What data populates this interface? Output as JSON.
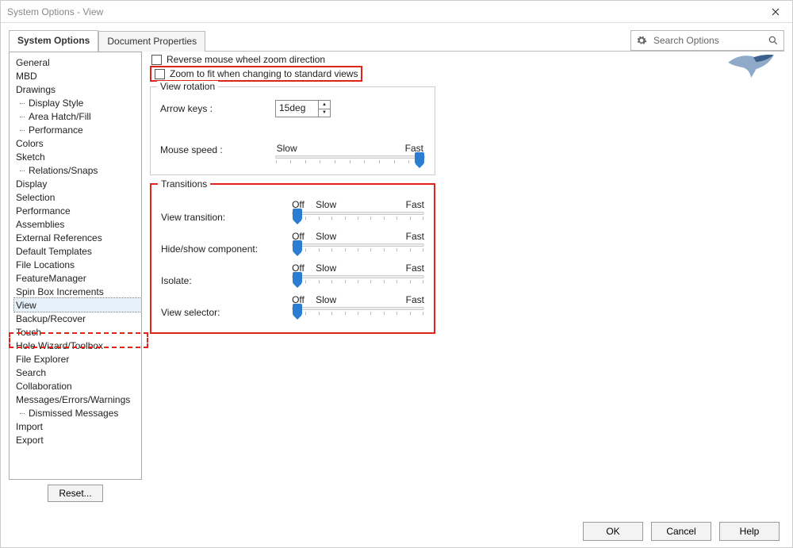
{
  "window": {
    "title": "System Options - View"
  },
  "tabs": {
    "system_options": "System Options",
    "document_properties": "Document Properties"
  },
  "search": {
    "placeholder": "Search Options"
  },
  "sidebar": {
    "items": [
      {
        "label": "General"
      },
      {
        "label": "MBD"
      },
      {
        "label": "Drawings"
      },
      {
        "label": "Display Style",
        "child": true
      },
      {
        "label": "Area Hatch/Fill",
        "child": true
      },
      {
        "label": "Performance",
        "child": true
      },
      {
        "label": "Colors"
      },
      {
        "label": "Sketch"
      },
      {
        "label": "Relations/Snaps",
        "child": true
      },
      {
        "label": "Display"
      },
      {
        "label": "Selection"
      },
      {
        "label": "Performance"
      },
      {
        "label": "Assemblies"
      },
      {
        "label": "External References"
      },
      {
        "label": "Default Templates"
      },
      {
        "label": "File Locations"
      },
      {
        "label": "FeatureManager"
      },
      {
        "label": "Spin Box Increments"
      },
      {
        "label": "View",
        "active": true
      },
      {
        "label": "Backup/Recover"
      },
      {
        "label": "Touch"
      },
      {
        "label": "Hole Wizard/Toolbox"
      },
      {
        "label": "File Explorer"
      },
      {
        "label": "Search"
      },
      {
        "label": "Collaboration"
      },
      {
        "label": "Messages/Errors/Warnings"
      },
      {
        "label": "Dismissed Messages",
        "child": true
      },
      {
        "label": "Import"
      },
      {
        "label": "Export"
      }
    ],
    "reset": "Reset..."
  },
  "main": {
    "check1": "Reverse mouse wheel zoom direction",
    "check2": "Zoom to fit when changing to standard views",
    "view_rotation": {
      "title": "View rotation",
      "arrow_keys_label": "Arrow keys :",
      "arrow_keys_value": "15deg",
      "mouse_speed_label": "Mouse speed :",
      "slow": "Slow",
      "fast": "Fast"
    },
    "transitions": {
      "title": "Transitions",
      "off": "Off",
      "slow": "Slow",
      "fast": "Fast",
      "rows": [
        {
          "label": "View transition:"
        },
        {
          "label": "Hide/show component:"
        },
        {
          "label": "Isolate:"
        },
        {
          "label": "View selector:"
        }
      ]
    }
  },
  "footer": {
    "ok": "OK",
    "cancel": "Cancel",
    "help": "Help"
  }
}
